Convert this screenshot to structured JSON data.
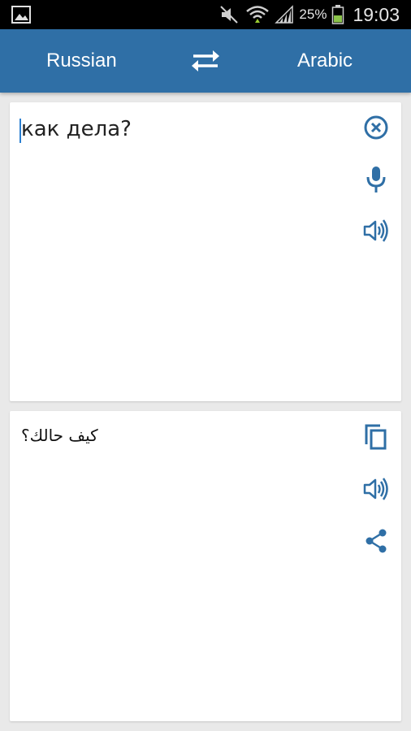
{
  "status_bar": {
    "battery_percent": "25%",
    "time": "19:03"
  },
  "colors": {
    "app_bar": "#2f6fa6",
    "accent_icon": "#2f6fa6",
    "cursor": "#2a7fd1"
  },
  "toolbar": {
    "source_language": "Russian",
    "target_language": "Arabic"
  },
  "input_card": {
    "text": "как дела?"
  },
  "output_card": {
    "text": "كيف حالك؟"
  },
  "icons": {
    "clear": "clear-icon",
    "microphone": "microphone-icon",
    "speaker": "speaker-icon",
    "copy": "copy-icon",
    "share": "share-icon",
    "swap": "swap-languages-icon"
  }
}
